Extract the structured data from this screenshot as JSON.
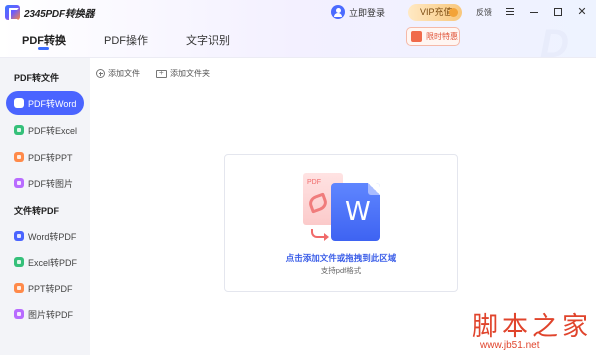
{
  "app": {
    "title": "2345PDF转换器"
  },
  "header": {
    "login_label": "立即登录",
    "vip_label": "VIP充值",
    "feedback_label": "反馈",
    "promo_label": "限时特惠"
  },
  "tabs": [
    {
      "label": "PDF转换",
      "active": true
    },
    {
      "label": "PDF操作",
      "active": false
    },
    {
      "label": "文字识别",
      "active": false
    }
  ],
  "sidebar": {
    "sections": [
      {
        "title": "PDF转文件",
        "items": [
          {
            "label": "PDF转Word",
            "active": true,
            "color": "#4a64ff"
          },
          {
            "label": "PDF转Excel",
            "active": false,
            "color": "#35c07a"
          },
          {
            "label": "PDF转PPT",
            "active": false,
            "color": "#ff8a4a"
          },
          {
            "label": "PDF转图片",
            "active": false,
            "color": "#b86bff"
          }
        ]
      },
      {
        "title": "文件转PDF",
        "items": [
          {
            "label": "Word转PDF",
            "active": false,
            "color": "#4a64ff"
          },
          {
            "label": "Excel转PDF",
            "active": false,
            "color": "#35c07a"
          },
          {
            "label": "PPT转PDF",
            "active": false,
            "color": "#ff8a4a"
          },
          {
            "label": "图片转PDF",
            "active": false,
            "color": "#b86bff"
          }
        ]
      }
    ]
  },
  "toolbar": {
    "add_file_label": "添加文件",
    "add_folder_label": "添加文件夹"
  },
  "drop_zone": {
    "pdf_label": "PDF",
    "word_label": "W",
    "title": "点击添加文件或拖拽到此区域",
    "subtitle": "支持pdf格式"
  },
  "watermark": {
    "text": "脚本之家",
    "url": "www.jb51.net"
  },
  "colors": {
    "accent": "#4a64ff",
    "link": "#3b5ee8"
  }
}
